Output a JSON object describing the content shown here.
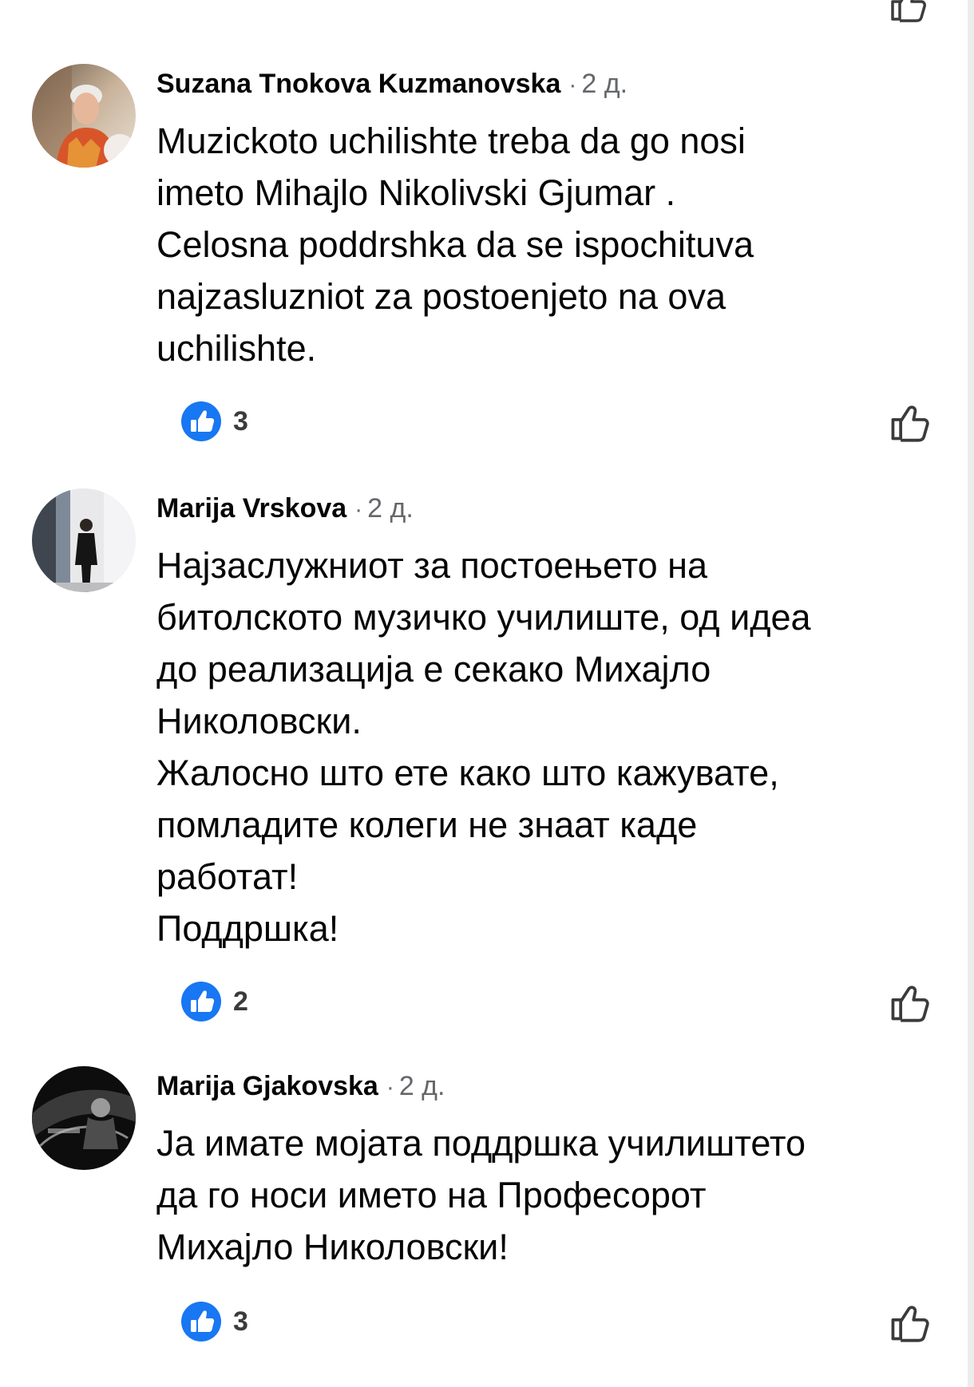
{
  "comments": [
    {
      "author": "Suzana Tnokova Kuzmanovska",
      "separator": "·",
      "time": "2 д.",
      "lines": [
        "Muzickoto uchilishte treba da go nosi",
        "imeto Mihajlo Nikolivski Gjumar .",
        "Celosna poddrshka da se ispochituva",
        "najzasluzniot za postoenjeto na ova",
        "uchilishte."
      ],
      "like_count": "3"
    },
    {
      "author": "Marija Vrskova",
      "separator": "·",
      "time": "2 д.",
      "lines": [
        "Најзаслужниот за постоењето на",
        "битолското музичко училиште, од идеа",
        "до реализација е секако Михајло",
        "Николовски.",
        "Жалосно што ете како што кажувате,",
        "помладите колеги не знаат каде",
        "работат!",
        "Поддршка!"
      ],
      "like_count": "2"
    },
    {
      "author": "Marija Gjakovska",
      "separator": "·",
      "time": "2 д.",
      "lines": [
        "Ја имате мојата поддршка училиштето",
        "да го носи името на Професорот",
        "Михајло Николовски!"
      ],
      "like_count": "3"
    }
  ],
  "icons": {
    "reaction_badge": "like-reaction-icon",
    "like_button": "thumbs-up-outline-icon"
  },
  "colors": {
    "like_blue": "#1877f2",
    "secondary_text": "#65676b",
    "primary_text": "#050505"
  }
}
